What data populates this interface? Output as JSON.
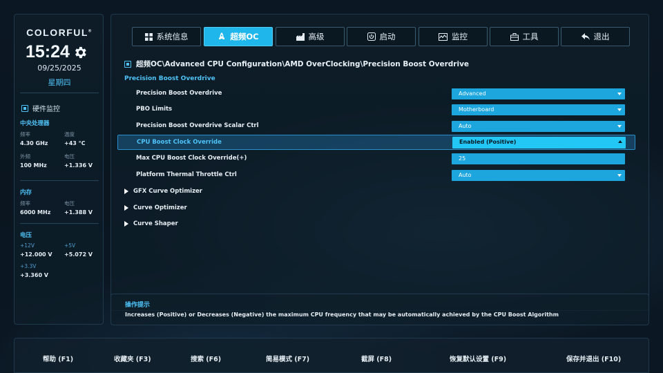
{
  "sidebar": {
    "brand": "COLORFUL",
    "brand_mark": "®",
    "time": "15:24",
    "date": "09/25/2025",
    "weekday": "星期四",
    "hw_title": "硬件监控",
    "cpu": {
      "title": "中央处理器",
      "freq_label": "频率",
      "freq_value": "4.30 GHz",
      "temp_label": "温度",
      "temp_value": "+43 °C",
      "bclk_label": "外频",
      "bclk_value": "100 MHz",
      "volt_label": "电压",
      "volt_value": "+1.336 V"
    },
    "memory": {
      "title": "内存",
      "freq_label": "频率",
      "freq_value": "6000 MHz",
      "volt_label": "电压",
      "volt_value": "+1.388 V"
    },
    "voltage": {
      "title": "电压",
      "v12_label": "+12V",
      "v12_value": "+12.000 V",
      "v5_label": "+5V",
      "v5_value": "+5.072 V",
      "v33_label": "+3.3V",
      "v33_value": "+3.360 V"
    }
  },
  "tabs": [
    {
      "label": "系统信息",
      "icon": "grid-icon"
    },
    {
      "label": "超频OC",
      "icon": "rocket-icon",
      "active": true
    },
    {
      "label": "高级",
      "icon": "chip-icon"
    },
    {
      "label": "启动",
      "icon": "power-icon"
    },
    {
      "label": "监控",
      "icon": "monitor-icon"
    },
    {
      "label": "工具",
      "icon": "toolbox-icon"
    },
    {
      "label": "退出",
      "icon": "back-arrow-icon"
    }
  ],
  "breadcrumb": "超频OC\\Advanced CPU Configuration\\AMD OverClocking\\Precision Boost Overdrive",
  "section_title": "Precision Boost Overdrive",
  "settings": [
    {
      "label": "Precision Boost Overdrive",
      "value": "Advanced"
    },
    {
      "label": "PBO Limits",
      "value": "Motherboard"
    },
    {
      "label": "Precision Boost Overdrive Scalar Ctrl",
      "value": "Auto"
    },
    {
      "label": "CPU Boost Clock Override",
      "value": "Enabled (Positive)"
    },
    {
      "label": "Max CPU Boost Clock Override(+)",
      "value": "25"
    },
    {
      "label": "Platform Thermal Throttle Ctrl",
      "value": "Auto"
    }
  ],
  "submenus": [
    {
      "label": "GFX Curve Optimizer"
    },
    {
      "label": "Curve Optimizer"
    },
    {
      "label": "Curve Shaper"
    }
  ],
  "help": {
    "title": "操作提示",
    "text": "Increases (Positive) or Decreases (Negative) the maximum CPU frequency that may be automatically achieved by the CPU Boost Algorithm"
  },
  "footer": [
    {
      "label": "帮助 (F1)"
    },
    {
      "label": "收藏夹 (F3)"
    },
    {
      "label": "搜索 (F6)"
    },
    {
      "label": "简易模式 (F7)"
    },
    {
      "label": "截屏 (F8)"
    },
    {
      "label": "恢复默认设置 (F9)"
    },
    {
      "label": "保存并退出 (F10)"
    }
  ],
  "colors": {
    "accent": "#1fb6ec",
    "highlight": "#22c7f5",
    "label_blue": "#4fc3f7"
  }
}
